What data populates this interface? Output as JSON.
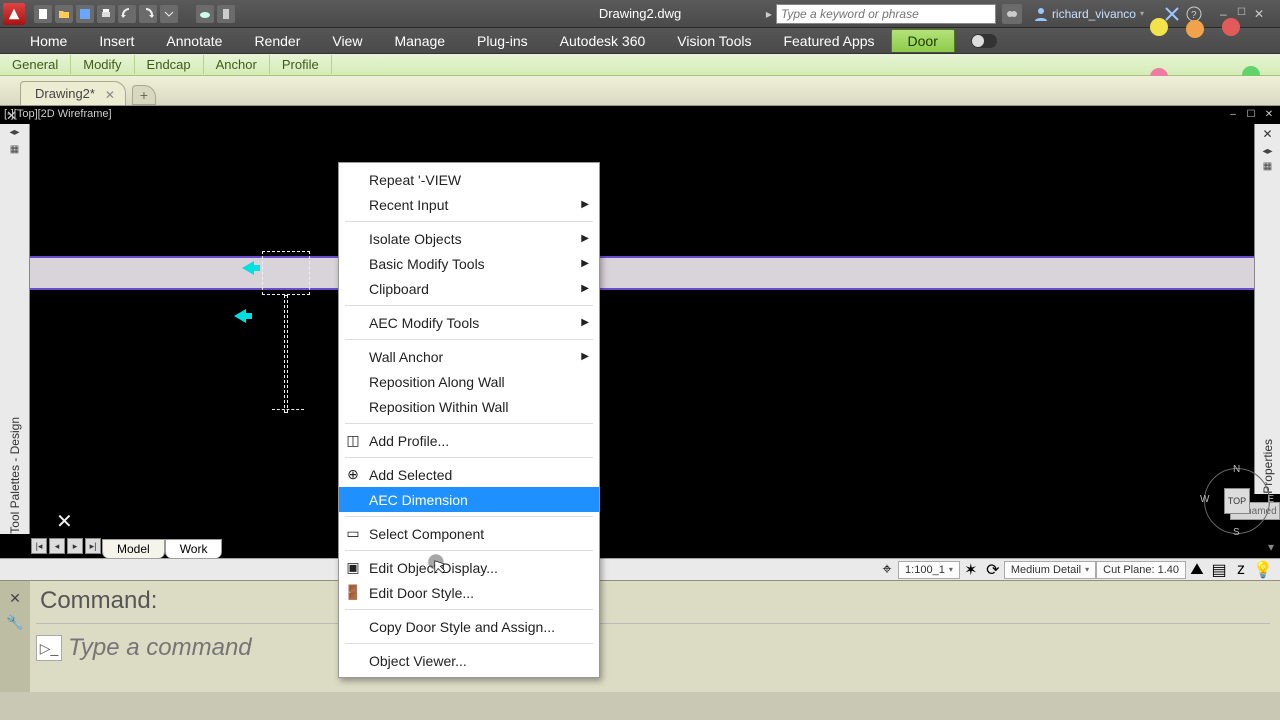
{
  "title": "Drawing2.dwg",
  "search_placeholder": "Type a keyword or phrase",
  "user_name": "richard_vivanco",
  "ribbon_tabs": [
    "Home",
    "Insert",
    "Annotate",
    "Render",
    "View",
    "Manage",
    "Plug-ins",
    "Autodesk 360",
    "Vision Tools",
    "Featured Apps",
    "Door"
  ],
  "ribbon_active_index": 10,
  "ribbon_panels": [
    "General",
    "Modify",
    "Endcap",
    "Anchor",
    "Profile"
  ],
  "doc_tab": "Drawing2*",
  "viewport_label": "[-][Top][2D Wireframe]",
  "palette_title": "Tool Palettes - Design",
  "props_title": "Properties",
  "props_badge": "Unnamed",
  "bottom_tabs": {
    "model": "Model",
    "work": "Work"
  },
  "status": {
    "scale": "1:100_1",
    "detail": "Medium Detail",
    "cutplane": "Cut Plane: 1.40"
  },
  "command_history": "Command:",
  "command_placeholder": "Type a command",
  "context_menu": {
    "items": [
      {
        "label": "Repeat '-VIEW",
        "sub": false
      },
      {
        "label": "Recent Input",
        "sub": true
      },
      {
        "label": "__sep"
      },
      {
        "label": "Isolate Objects",
        "sub": true
      },
      {
        "label": "Basic Modify Tools",
        "sub": true
      },
      {
        "label": "Clipboard",
        "sub": true
      },
      {
        "label": "__sep"
      },
      {
        "label": "AEC Modify Tools",
        "sub": true
      },
      {
        "label": "__sep"
      },
      {
        "label": "Wall Anchor",
        "sub": true
      },
      {
        "label": "Reposition Along Wall",
        "sub": false
      },
      {
        "label": "Reposition Within Wall",
        "sub": false
      },
      {
        "label": "__sep"
      },
      {
        "label": "Add Profile...",
        "sub": false,
        "ico": "profile"
      },
      {
        "label": "__sep"
      },
      {
        "label": "Add Selected",
        "sub": false,
        "ico": "addsel"
      },
      {
        "label": "AEC Dimension",
        "sub": false,
        "hl": true
      },
      {
        "label": "__sep"
      },
      {
        "label": "Select Component",
        "sub": false,
        "ico": "selcomp"
      },
      {
        "label": "__sep"
      },
      {
        "label": "Edit Object Display...",
        "sub": false,
        "ico": "disp"
      },
      {
        "label": "Edit Door Style...",
        "sub": false,
        "ico": "doorstyle"
      },
      {
        "label": "__sep"
      },
      {
        "label": "Copy Door Style and Assign...",
        "sub": false
      },
      {
        "label": "__sep"
      },
      {
        "label": "Object Viewer...",
        "sub": false
      }
    ]
  },
  "viewcube": {
    "n": "N",
    "s": "S",
    "e": "E",
    "w": "W",
    "face": "TOP"
  }
}
